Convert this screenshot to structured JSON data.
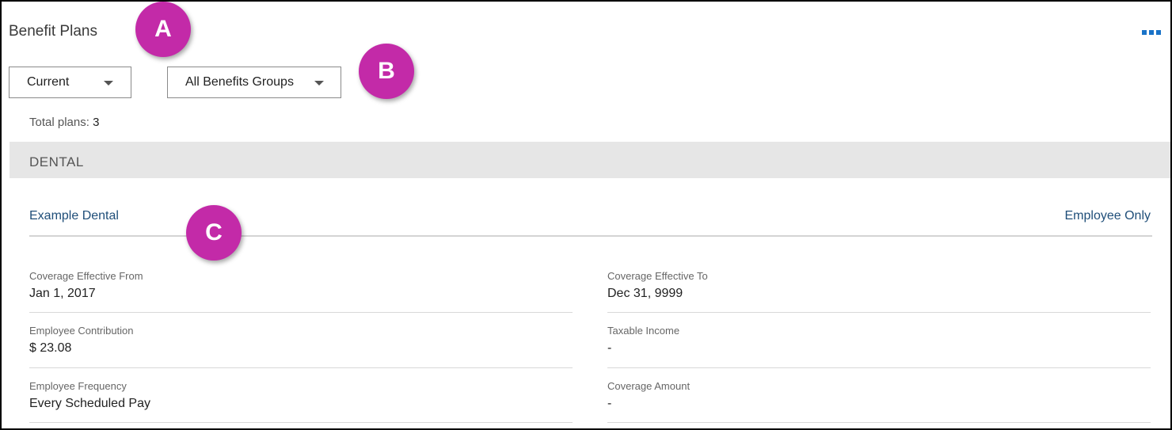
{
  "header": {
    "title": "Benefit Plans",
    "more_icon": "more-horizontal-icon"
  },
  "filters": {
    "status": {
      "selected": "Current"
    },
    "group": {
      "selected": "All Benefits Groups"
    }
  },
  "summary": {
    "label": "Total plans:",
    "count": "3"
  },
  "section": {
    "title": "DENTAL"
  },
  "plan": {
    "name": "Example Dental",
    "tier": "Employee Only",
    "fields": [
      {
        "label": "Coverage Effective From",
        "value": "Jan 1, 2017"
      },
      {
        "label": "Coverage Effective To",
        "value": "Dec 31, 9999"
      },
      {
        "label": "Employee Contribution",
        "value": "$ 23.08"
      },
      {
        "label": "Taxable Income",
        "value": "-"
      },
      {
        "label": "Employee Frequency",
        "value": "Every Scheduled Pay"
      },
      {
        "label": "Coverage Amount",
        "value": "-"
      }
    ]
  },
  "callouts": {
    "a": "A",
    "b": "B",
    "c": "C"
  },
  "colors": {
    "accent": "#1a73c8",
    "link": "#1f4e79",
    "callout": "#c32aa8",
    "section_bg": "#e6e6e6"
  }
}
